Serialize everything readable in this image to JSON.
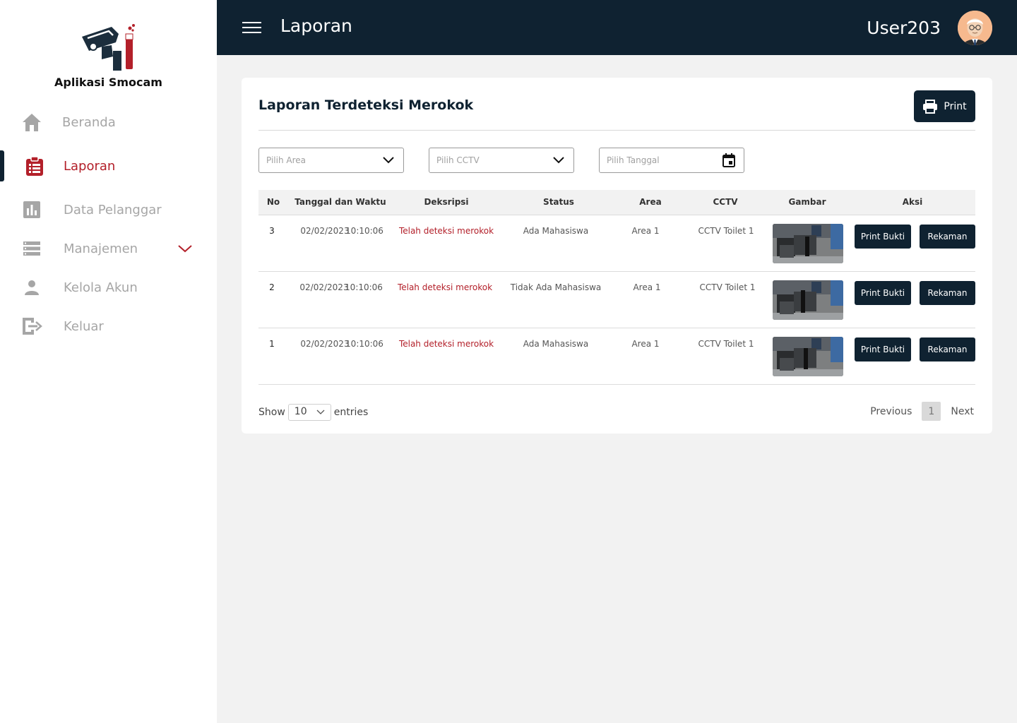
{
  "sidebar": {
    "app_name": "Aplikasi Smocam",
    "items": [
      {
        "label": "Beranda"
      },
      {
        "label": "Laporan"
      },
      {
        "label": "Data Pelanggar"
      },
      {
        "label": "Manajemen"
      },
      {
        "label": "Kelola Akun"
      },
      {
        "label": "Keluar"
      }
    ]
  },
  "topbar": {
    "title": "Laporan",
    "username": "User203"
  },
  "card": {
    "title": "Laporan Terdeteksi Merokok",
    "print_label": "Print",
    "filters": {
      "area": "Pilih Area",
      "cctv": "Pilih CCTV",
      "date": "Pilih Tanggal"
    }
  },
  "table": {
    "headers": {
      "no": "No",
      "datetime": "Tanggal dan Waktu",
      "desc": "Deksripsi",
      "status": "Status",
      "area": "Area",
      "cctv": "CCTV",
      "image": "Gambar",
      "action": "Aksi"
    },
    "rows": [
      {
        "no": "3",
        "date": "02/02/2023",
        "time": "10:10:06",
        "desc": "Telah deteksi merokok",
        "status": "Ada Mahasiswa",
        "area": "Area 1",
        "cctv": "CCTV Toilet 1",
        "btn_print": "Print Bukti",
        "btn_record": "Rekaman"
      },
      {
        "no": "2",
        "date": "02/02/2023",
        "time": "10:10:06",
        "desc": "Telah deteksi merokok",
        "status": "Tidak Ada Mahasiswa",
        "area": "Area 1",
        "cctv": "CCTV Toilet 1",
        "btn_print": "Print Bukti",
        "btn_record": "Rekaman"
      },
      {
        "no": "1",
        "date": "02/02/2023",
        "time": "10:10:06",
        "desc": "Telah deteksi merokok",
        "status": "Ada Mahasiswa",
        "area": "Area 1",
        "cctv": "CCTV Toilet 1",
        "btn_print": "Print Bukti",
        "btn_record": "Rekaman"
      }
    ]
  },
  "footer": {
    "show_label": "Show",
    "page_size": "10",
    "entries_label": "entries",
    "previous": "Previous",
    "current_page": "1",
    "next": "Next"
  },
  "colors": {
    "navy": "#0f2231",
    "accent_red": "#b3202a",
    "muted_gray": "#a6a6a6"
  },
  "icons": [
    "camera-logo-icon",
    "home-icon",
    "clipboard-list-icon",
    "bar-chart-icon",
    "server-list-icon",
    "chevron-down-icon",
    "user-icon",
    "logout-icon",
    "hamburger-icon",
    "printer-icon",
    "calendar-icon"
  ]
}
